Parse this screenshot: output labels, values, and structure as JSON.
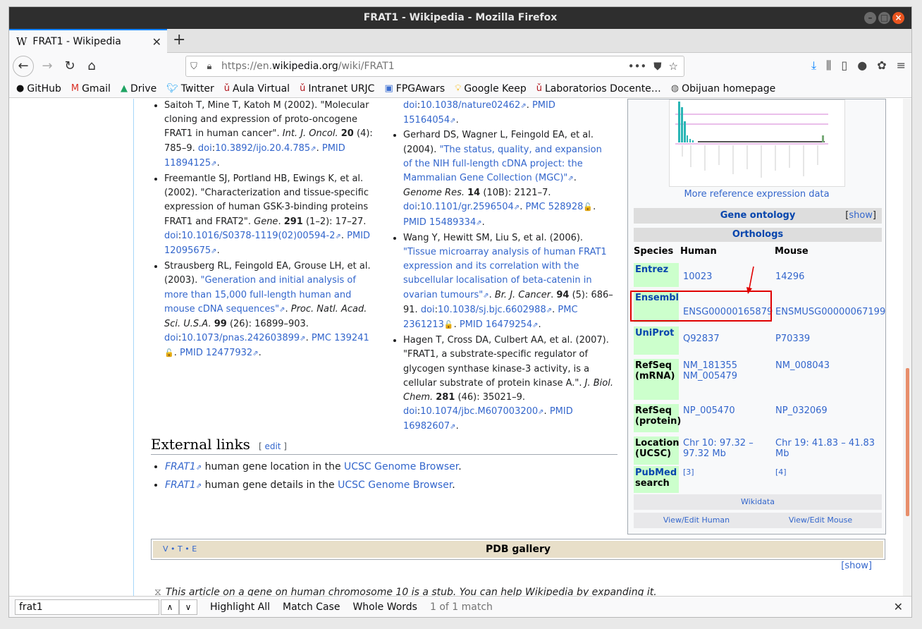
{
  "window": {
    "title": "FRAT1 - Wikipedia - Mozilla Firefox"
  },
  "tab": {
    "title": "FRAT1 - Wikipedia",
    "favicon": "W"
  },
  "url": {
    "prefix": "https://en.",
    "domain": "wikipedia.org",
    "path": "/wiki/FRAT1"
  },
  "bookmarks": [
    {
      "label": "GitHub",
      "icon": "github-icon"
    },
    {
      "label": "Gmail",
      "icon": "gmail-icon"
    },
    {
      "label": "Drive",
      "icon": "drive-icon"
    },
    {
      "label": "Twitter",
      "icon": "twitter-icon"
    },
    {
      "label": "Aula Virtual",
      "icon": "urjc-icon"
    },
    {
      "label": "Intranet URJC",
      "icon": "urjc-icon"
    },
    {
      "label": "FPGAwars",
      "icon": "fpgawars-icon"
    },
    {
      "label": "Google Keep",
      "icon": "keep-icon"
    },
    {
      "label": "Laboratorios Docente…",
      "icon": "urjc-icon"
    },
    {
      "label": "Obijuan homepage",
      "icon": "globe-icon"
    }
  ],
  "refs_left": [
    {
      "html": "Saitoh T, Mine T, Katoh M (2002). \"Molecular cloning and expression of proto-oncogene FRAT1 in human cancer\". <i>Int. J. Oncol.</i> <b>20</b> (4): 785–9. <span class='lnk'>doi</span>:<span class='lnk'>10.3892/ijo.20.4.785</span><span class='ext'>⇗</span>. <span class='lnk'>PMID</span> <span class='lnk'>11894125</span><span class='ext'>⇗</span>."
    },
    {
      "html": "Freemantle SJ, Portland HB, Ewings K, et al. (2002). \"Characterization and tissue-specific expression of human GSK-3-binding proteins FRAT1 and FRAT2\". <i>Gene</i>. <b>291</b> (1–2): 17–27. <span class='lnk'>doi</span>:<span class='lnk'>10.1016/S0378-1119(02)00594-2</span><span class='ext'>⇗</span>. <span class='lnk'>PMID</span> <span class='lnk'>12095675</span><span class='ext'>⇗</span>."
    },
    {
      "html": "Strausberg RL, Feingold EA, Grouse LH, et al. (2003). <span class='lnk'>\"Generation and initial analysis of more than 15,000 full-length human and mouse cDNA sequences\"</span><span class='ext'>⇗</span>. <i>Proc. Natl. Acad. Sci. U.S.A.</i> <b>99</b> (26): 16899–903. <span class='lnk'>doi</span>:<span class='lnk'>10.1073/pnas.242603899</span><span class='ext'>⇗</span>. <span class='lnk'>PMC</span> <span class='lnk'>139241</span><span class='lock'>🔓</span>. <span class='lnk'>PMID</span> <span class='lnk'>12477932</span><span class='ext'>⇗</span>."
    }
  ],
  "refs_right_top": "<span class='lnk'>doi</span>:<span class='lnk'>10.1038/nature02462</span><span class='ext'>⇗</span>. <span class='lnk'>PMID</span> <span class='lnk'>15164054</span><span class='ext'>⇗</span>.",
  "refs_right": [
    {
      "html": "Gerhard DS, Wagner L, Feingold EA, et al. (2004). <span class='lnk'>\"The status, quality, and expansion of the NIH full-length cDNA project: the Mammalian Gene Collection (MGC)\"</span><span class='ext'>⇗</span>. <i>Genome Res.</i> <b>14</b> (10B): 2121–7. <span class='lnk'>doi</span>:<span class='lnk'>10.1101/gr.2596504</span><span class='ext'>⇗</span>. <span class='lnk'>PMC</span> <span class='lnk'>528928</span><span class='lock'>🔓</span>. <span class='lnk'>PMID</span> <span class='lnk'>15489334</span><span class='ext'>⇗</span>."
    },
    {
      "html": "Wang Y, Hewitt SM, Liu S, et al. (2006). <span class='lnk'>\"Tissue microarray analysis of human FRAT1 expression and its correlation with the subcellular localisation of beta-catenin in ovarian tumours\"</span><span class='ext'>⇗</span>. <i>Br. J. Cancer</i>. <b>94</b> (5): 686–91. <span class='lnk'>doi</span>:<span class='lnk'>10.1038/sj.bjc.6602988</span><span class='ext'>⇗</span>. <span class='lnk'>PMC</span> <span class='lnk'>2361213</span><span class='lock'>🔓</span>. <span class='lnk'>PMID</span> <span class='lnk'>16479254</span><span class='ext'>⇗</span>."
    },
    {
      "html": "Hagen T, Cross DA, Culbert AA, et al. (2007). \"FRAT1, a substrate-specific regulator of glycogen synthase kinase-3 activity, is a cellular substrate of protein kinase A.\". <i>J. Biol. Chem.</i> <b>281</b> (46): 35021–9. <span class='lnk'>doi</span>:<span class='lnk'>10.1074/jbc.M607003200</span><span class='ext'>⇗</span>. <span class='lnk'>PMID</span> <span class='lnk'>16982607</span><span class='ext'>⇗</span>."
    }
  ],
  "section": {
    "title": "External links",
    "edit": "edit"
  },
  "external_links": [
    {
      "link": "FRAT1",
      "text": " human gene location in the ",
      "site": "UCSC Genome Browser"
    },
    {
      "link": "FRAT1",
      "text": " human gene details in the ",
      "site": "UCSC Genome Browser"
    }
  ],
  "infobox": {
    "expr_link": "More reference expression data",
    "gene_ontology": "Gene ontology",
    "show": "show",
    "orthologs": "Orthologs",
    "col_species": "Species",
    "col_human": "Human",
    "col_mouse": "Mouse",
    "rows": [
      {
        "label": "Entrez",
        "human": "10023",
        "mouse": "14296"
      },
      {
        "label": "Ensembl",
        "human": "ENSG00000165879",
        "mouse": "ENSMUSG00000067199"
      },
      {
        "label": "UniProt",
        "human": "Q92837",
        "mouse": "P70339"
      },
      {
        "label": "RefSeq (mRNA)",
        "human": "NM_181355\nNM_005479",
        "mouse": "NM_008043"
      },
      {
        "label": "RefSeq (protein)",
        "human": "NP_005470",
        "mouse": "NP_032069"
      },
      {
        "label": "Location (UCSC)",
        "human": "Chr 10: 97.32 – 97.32 Mb",
        "mouse": "Chr 19: 41.83 – 41.83 Mb"
      },
      {
        "label": "PubMed search",
        "human": "[3]",
        "mouse": "[4]"
      }
    ],
    "wikidata": "Wikidata",
    "view_human": "View/Edit Human",
    "view_mouse": "View/Edit Mouse"
  },
  "navbox": {
    "vte": "V • T • E",
    "title": "PDB gallery",
    "show": "show"
  },
  "stub": "This article on a gene on human chromosome 10 is a stub. You can help Wikipedia by expanding it.",
  "find": {
    "query": "frat1",
    "highlight_all": "Highlight All",
    "match_case": "Match Case",
    "whole_words": "Whole Words",
    "status": "1 of 1 match"
  },
  "colors": {
    "accent": "#0a84ff",
    "link": "#3366cc",
    "highlight_box": "#e00000",
    "species_bg": "#ccffcc"
  }
}
